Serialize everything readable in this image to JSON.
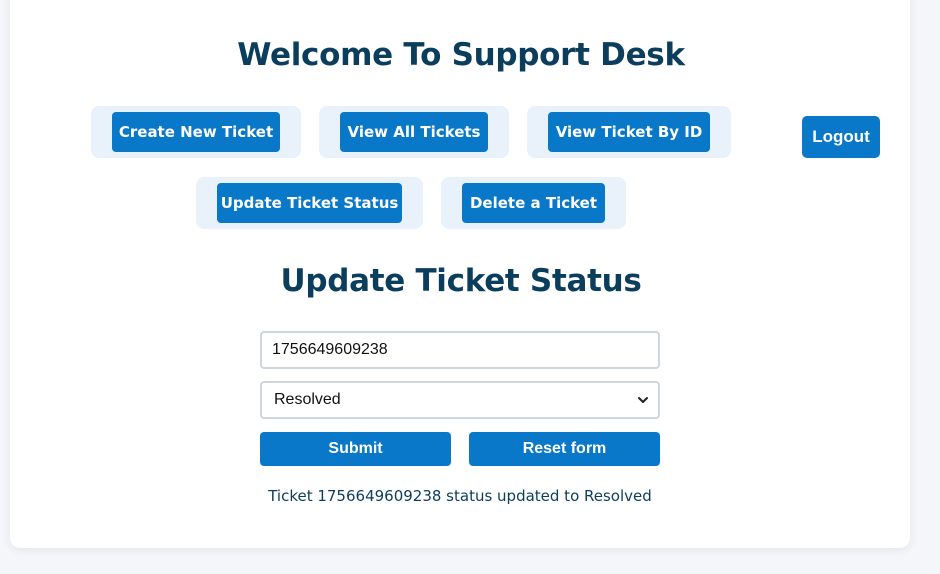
{
  "header": {
    "title": "Welcome To Support Desk"
  },
  "nav": {
    "create_label": "Create New Ticket",
    "view_all_label": "View All Tickets",
    "view_by_id_label": "View Ticket By ID",
    "update_status_label": "Update Ticket Status",
    "delete_label": "Delete a Ticket",
    "logout_label": "Logout"
  },
  "form": {
    "title": "Update Ticket Status",
    "ticket_id_value": "1756649609238",
    "status_selected": "Resolved",
    "submit_label": "Submit",
    "reset_label": "Reset form"
  },
  "result": {
    "message": "Ticket 1756649609238 status updated to Resolved"
  },
  "colors": {
    "accent": "#0a78c9",
    "heading": "#0b3d5c",
    "nav_bg": "#e9f2fb"
  }
}
